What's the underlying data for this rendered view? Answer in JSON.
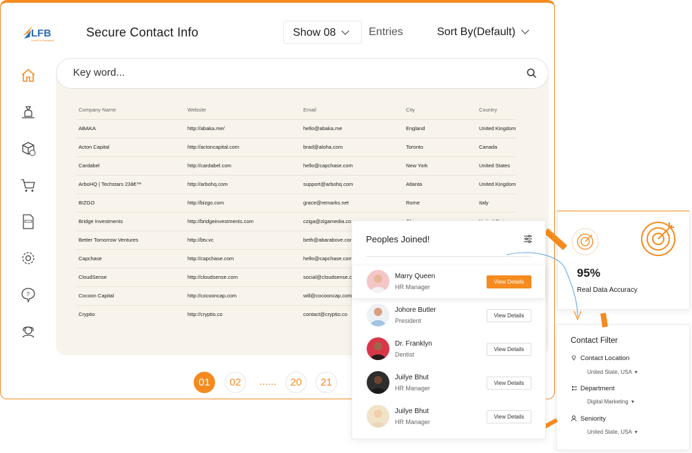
{
  "header": {
    "logo_text": "LFB",
    "logo_tagline": "Lead For Business",
    "title": "Secure Contact Info",
    "show_label": "Show 08",
    "entries_label": "Entries",
    "sort_label": "Sort By(Default)"
  },
  "search": {
    "placeholder": "Key word..."
  },
  "sidebar": {
    "items": [
      {
        "icon": "home-icon"
      },
      {
        "icon": "money-bag-icon"
      },
      {
        "icon": "package-check-icon"
      },
      {
        "icon": "shopping-cart-icon"
      },
      {
        "icon": "invoice-icon"
      },
      {
        "icon": "settings-gear-icon"
      },
      {
        "icon": "help-bubble-icon"
      },
      {
        "icon": "support-agent-icon"
      }
    ]
  },
  "table": {
    "headers": [
      "Company Name",
      "Website",
      "Email",
      "City",
      "Country"
    ],
    "rows": [
      [
        "ABAKA",
        "http://abaka.me/",
        "hello@abaka.me",
        "England",
        "United Kingdom"
      ],
      [
        "Acton Capital",
        "http://actoncapital.com",
        "brad@aloha.com",
        "Toronto",
        "Canada"
      ],
      [
        "Cardabel",
        "http://cardabel.com",
        "hello@capchase.com",
        "New York",
        "United States"
      ],
      [
        "ArboHQ | Techstars 23â€™",
        "http://arbohq.com",
        "support@arbohq.com",
        "Atlanta",
        "United Kingdom"
      ],
      [
        "BIZGO",
        "http://bizgo.com",
        "grace@remarks.net",
        "Rome",
        "Italy"
      ],
      [
        "Bridge Investments",
        "http://bridgeinvestments.com",
        "cziga@zigamedia.com",
        "Chicago",
        "United States"
      ],
      [
        "Better Tomorrow Ventures",
        "http://btv.vc",
        "beth@abarabove.com",
        "",
        ""
      ],
      [
        "Capchase",
        "http://capchase.com",
        "hello@capchase.com",
        "",
        ""
      ],
      [
        "CloudSense",
        "http://cloudsense.com",
        "social@cloudsense.com",
        "",
        ""
      ],
      [
        "Cocoon Capital",
        "http://cocooncap.com",
        "will@cocooncap.com",
        "",
        ""
      ],
      [
        "Cryptio",
        "http://cryptio.co",
        "contact@cryptio.co",
        "",
        ""
      ]
    ]
  },
  "pagination": {
    "pages": [
      "01",
      "02",
      "20",
      "21"
    ],
    "ellipsis": "......",
    "active": "01"
  },
  "people": {
    "title": "Peoples Joined!",
    "button_label": "View Details",
    "items": [
      {
        "name": "Marry Queen",
        "role": "HR Manager"
      },
      {
        "name": "Johore Butler",
        "role": "President"
      },
      {
        "name": "Dr. Franklyn",
        "role": "Dentist"
      },
      {
        "name": "Juilye Bhut",
        "role": "HR Manager"
      },
      {
        "name": "Juilye Bhut",
        "role": "HR Manager"
      }
    ]
  },
  "accuracy": {
    "value": "95%",
    "label": "Real Data Accuracy"
  },
  "contact_filter": {
    "title": "Contact Filter",
    "items": [
      {
        "label": "Contact Location",
        "value": "United State, USA"
      },
      {
        "label": "Department",
        "value": "Digital Marketing"
      },
      {
        "label": "Seniority",
        "value": "United State, USA"
      }
    ]
  },
  "colors": {
    "accent": "#f58a1f",
    "panel_bg": "#f8f4ec",
    "text": "#1d1d1d"
  }
}
